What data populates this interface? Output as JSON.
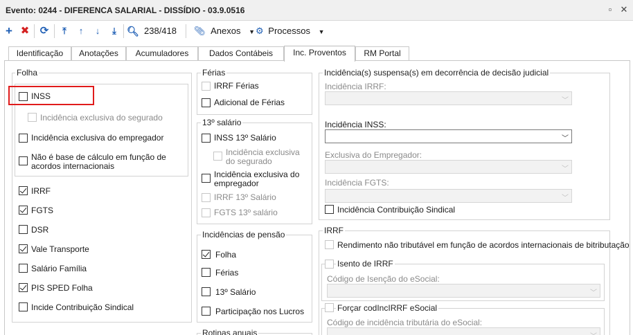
{
  "window": {
    "title": "Evento: 0244 - DIFERENCA SALARIAL - DISSÍDIO - 03.9.0516",
    "restore_icon": "restore-icon",
    "close_icon": "close-icon"
  },
  "toolbar": {
    "record_counter": "238/418",
    "anexos_label": "Anexos",
    "processos_label": "Processos"
  },
  "tabs": [
    "Identificação",
    "Anotações",
    "Acumuladores",
    "Dados Contábeis",
    "Inc. Proventos",
    "RM Portal"
  ],
  "folha": {
    "legend": "Folha",
    "inss": "INSS",
    "inc_segurado": "Incidência exclusiva do segurado",
    "inc_empregador": "Incidência exclusiva do empregador",
    "nao_base_1": "Não é base de cálculo em função de",
    "nao_base_2": "acordos internacionais",
    "irrf": "IRRF",
    "fgts": "FGTS",
    "dsr": "DSR",
    "vale_transporte": "Vale Transporte",
    "salario_familia": "Salário Família",
    "pis_sped": "PIS SPED Folha",
    "contrib_sindical": "Incide Contribuição Sindical"
  },
  "ferias": {
    "legend": "Férias",
    "irrf_ferias": "IRRF Férias",
    "adicional": "Adicional de Férias"
  },
  "decimo": {
    "legend": "13º salário",
    "inss13": "INSS 13º Salário",
    "inc_seg_1": "Incidência exclusiva",
    "inc_seg_2": "do segurado",
    "inc_emp_1": "Incidência exclusiva do",
    "inc_emp_2": "empregador",
    "irrf13": "IRRF 13º Salário",
    "fgts13": "FGTS 13º salário"
  },
  "pensao": {
    "legend": "Incidências de pensão",
    "folha": "Folha",
    "ferias": "Férias",
    "decimo": "13º Salário",
    "lucros": "Participação nos Lucros"
  },
  "rotinas": {
    "legend": "Rotinas anuais"
  },
  "judicial": {
    "legend": "Incidência(s) suspensa(s) em decorrência de decisão judicial",
    "irrf_label": "Incidência IRRF:",
    "inss_label": "Incidência INSS:",
    "empregador_label": "Exclusiva do Empregador:",
    "fgts_label": "Incidência FGTS:",
    "sindical": "Incidência Contribuição Sindical"
  },
  "irrf_section": {
    "legend": "IRRF",
    "rendimento": "Rendimento não tributável em função de acordos internacionais de bitributação",
    "isento": "Isento de IRRF",
    "codigo_isencao": "Código de Isenção do eSocial:",
    "forcar": "Forçar codIncIRRF eSocial",
    "codigo_incidencia": "Código de incidência tributária do eSocial:"
  }
}
